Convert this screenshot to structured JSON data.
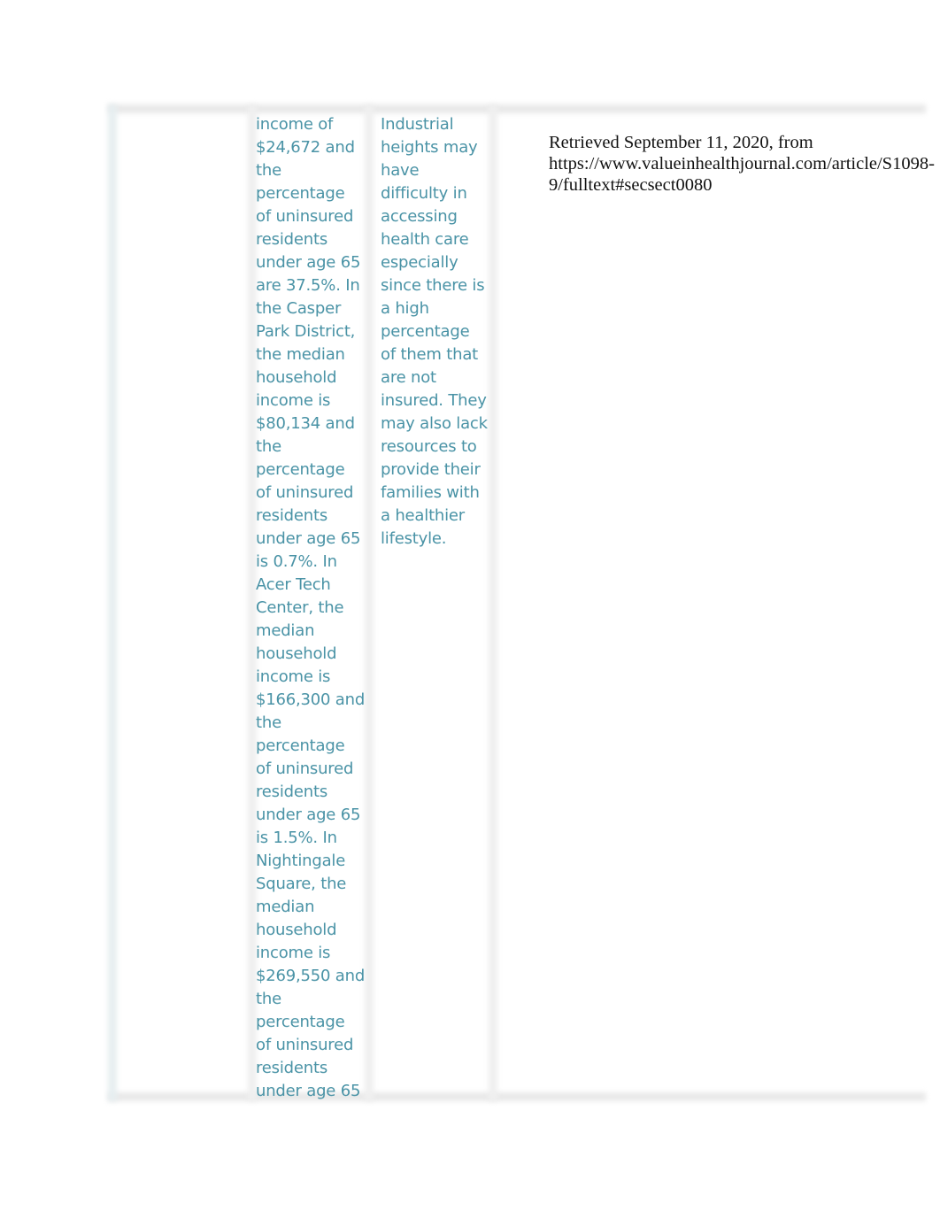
{
  "document": {
    "table": {
      "row": {
        "first_cell": "",
        "description_lines": [
          "income of",
          "$24,672 and",
          "the",
          "percentage",
          "of uninsured",
          "residents",
          "under age 65",
          "are 37.5%. In",
          "the Casper",
          "Park District,",
          "the median",
          "household",
          "income is",
          "$80,134 and",
          "the",
          "percentage",
          "of uninsured",
          "residents",
          "under age 65",
          "is 0.7%. In",
          "Acer Tech",
          "Center, the",
          "median",
          "household",
          "income is",
          "$166,300 and",
          "the",
          "percentage",
          "of uninsured",
          "residents",
          "under age 65",
          "is 1.5%. In",
          "Nightingale",
          "Square, the",
          "median",
          "household",
          "income is",
          "$269,550 and",
          "the",
          "percentage",
          "of uninsured",
          "residents",
          "under age 65"
        ],
        "impact_lines": [
          "Industrial",
          "heights may",
          "have",
          "difficulty in",
          "accessing",
          "health care",
          "especially",
          "since there is",
          "a high",
          "percentage",
          "of them that",
          "are not",
          "insured. They",
          "may also lack",
          "resources to",
          "provide their",
          "families with",
          "a healthier",
          "lifestyle."
        ],
        "reference_lines": [
          "Retrieved September 11, 2020, from",
          "https://www.valueinhealthjournal.com/article/S1098-",
          "9/fulltext#secsect0080"
        ]
      }
    }
  },
  "colors": {
    "cell_text": "#4a93a6",
    "reference_text": "#111111",
    "border": "#e9e9e9"
  }
}
